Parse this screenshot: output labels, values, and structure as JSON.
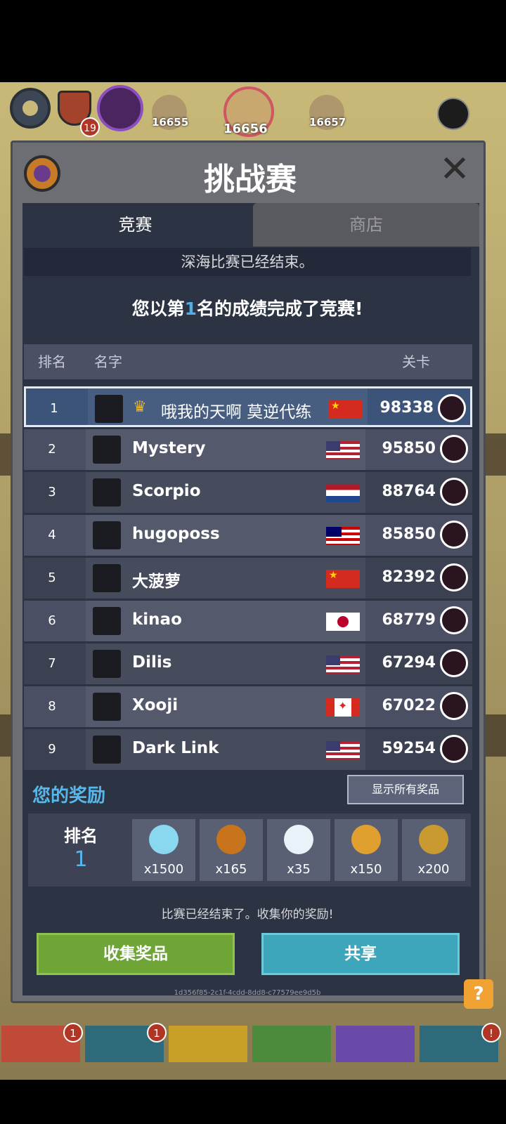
{
  "hud": {
    "shield_badge": "19",
    "floor_prev": "16655",
    "floor_current": "16656",
    "floor_next": "16657"
  },
  "dialog": {
    "title": "挑战赛",
    "tabs": [
      "竞赛",
      "商店"
    ],
    "notice": "深海比赛已经结束。",
    "result_prefix": "您以第",
    "result_rank": "1",
    "result_suffix": "名的成绩完成了竞赛!",
    "columns": {
      "rank": "排名",
      "name": "名字",
      "level": "关卡"
    }
  },
  "leaderboard": [
    {
      "rank": "1",
      "name": "哦我的天啊 莫逆代练",
      "flag": "cn",
      "score": "98338",
      "me": true,
      "avatar_icon": "sword-icon"
    },
    {
      "rank": "2",
      "name": "Mystery",
      "flag": "us",
      "score": "95850",
      "avatar_icon": "demon-mask-icon"
    },
    {
      "rank": "3",
      "name": "Scorpio",
      "flag": "nl",
      "score": "88764",
      "avatar_icon": "scorpion-icon"
    },
    {
      "rank": "4",
      "name": "hugoposs",
      "flag": "my",
      "score": "85850",
      "avatar_icon": "demon-mask-icon"
    },
    {
      "rank": "5",
      "name": "大菠萝",
      "flag": "cn",
      "score": "82392",
      "avatar_icon": "trophy-icon"
    },
    {
      "rank": "6",
      "name": "kinao",
      "flag": "jp",
      "score": "68779",
      "avatar_icon": "fox-icon"
    },
    {
      "rank": "7",
      "name": "Dilis",
      "flag": "us",
      "score": "67294",
      "avatar_icon": "pink-monster-icon"
    },
    {
      "rank": "8",
      "name": "Xooji",
      "flag": "ca",
      "score": "67022",
      "avatar_icon": "purple-monster-icon"
    },
    {
      "rank": "9",
      "name": "Dark Link",
      "flag": "us",
      "score": "59254",
      "avatar_icon": "portal-icon"
    }
  ],
  "rewards": {
    "title": "您的奖励",
    "show_all": "显示所有奖品",
    "rank_label": "排名",
    "rank_value": "1",
    "items": [
      {
        "icon": "diamond-icon",
        "qty": "x1500",
        "color": "#8ad8f0"
      },
      {
        "icon": "amber-crystal-icon",
        "qty": "x165",
        "color": "#c8741c"
      },
      {
        "icon": "egg-icon",
        "qty": "x35",
        "color": "#e8f2f8"
      },
      {
        "icon": "fox-token-icon",
        "qty": "x150",
        "color": "#e0a030"
      },
      {
        "icon": "gold-coin-icon",
        "qty": "x200",
        "color": "#c89a30"
      }
    ]
  },
  "footer": {
    "ended_text": "比赛已经结束了。收集你的奖励!",
    "collect_button": "收集奖品",
    "share_button": "共享",
    "uuid": "1d356f85-2c1f-4cdd-8dd8-c77579ee9d5b",
    "help": "?"
  },
  "bottom_tabs": [
    {
      "icon": "sword-icon",
      "color": "#c04a38",
      "badge": "1"
    },
    {
      "icon": "helmet-icon",
      "color": "#2e6a7a",
      "badge": "1"
    },
    {
      "icon": "armor-icon",
      "color": "#c8a028",
      "badge": ""
    },
    {
      "icon": "pet-icon",
      "color": "#4c8a3c",
      "badge": ""
    },
    {
      "icon": "heart-icon",
      "color": "#6a4aa8",
      "badge": ""
    },
    {
      "icon": "chest-icon",
      "color": "#2e6a7a",
      "badge": "!"
    }
  ]
}
